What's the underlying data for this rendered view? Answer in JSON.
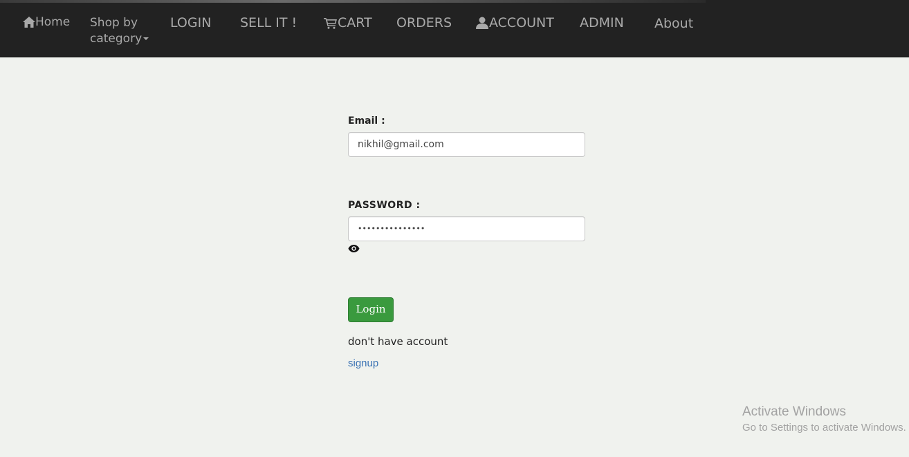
{
  "nav": {
    "home": "Home",
    "shop_line1": "Shop by",
    "shop_line2": "category",
    "login": "LOGIN",
    "sell": "SELL IT !",
    "cart": "CART",
    "orders": "ORDERS",
    "account": "ACCOUNT",
    "admin": "ADMIN",
    "about": "About"
  },
  "form": {
    "email_label": "Email  :",
    "email_value": "nikhil@gmail.com",
    "password_label": "PASSWORD  :",
    "password_value": "•••••••••••••••",
    "login_button": "Login",
    "no_account_text": "don't have account",
    "signup_link": "signup"
  },
  "watermark": {
    "title": "Activate Windows",
    "subtitle": "Go to Settings to activate Windows."
  },
  "icons": {
    "home": "home-icon",
    "caret": "caret-down-icon",
    "cart": "cart-icon",
    "account": "user-icon",
    "password_toggle": "eye-icon"
  },
  "colors": {
    "navbar_bg": "#222222",
    "nav_text": "#a9a9a9",
    "page_bg": "#f0f2ee",
    "login_button": "#3a9a3e",
    "link": "#3b73b4"
  }
}
